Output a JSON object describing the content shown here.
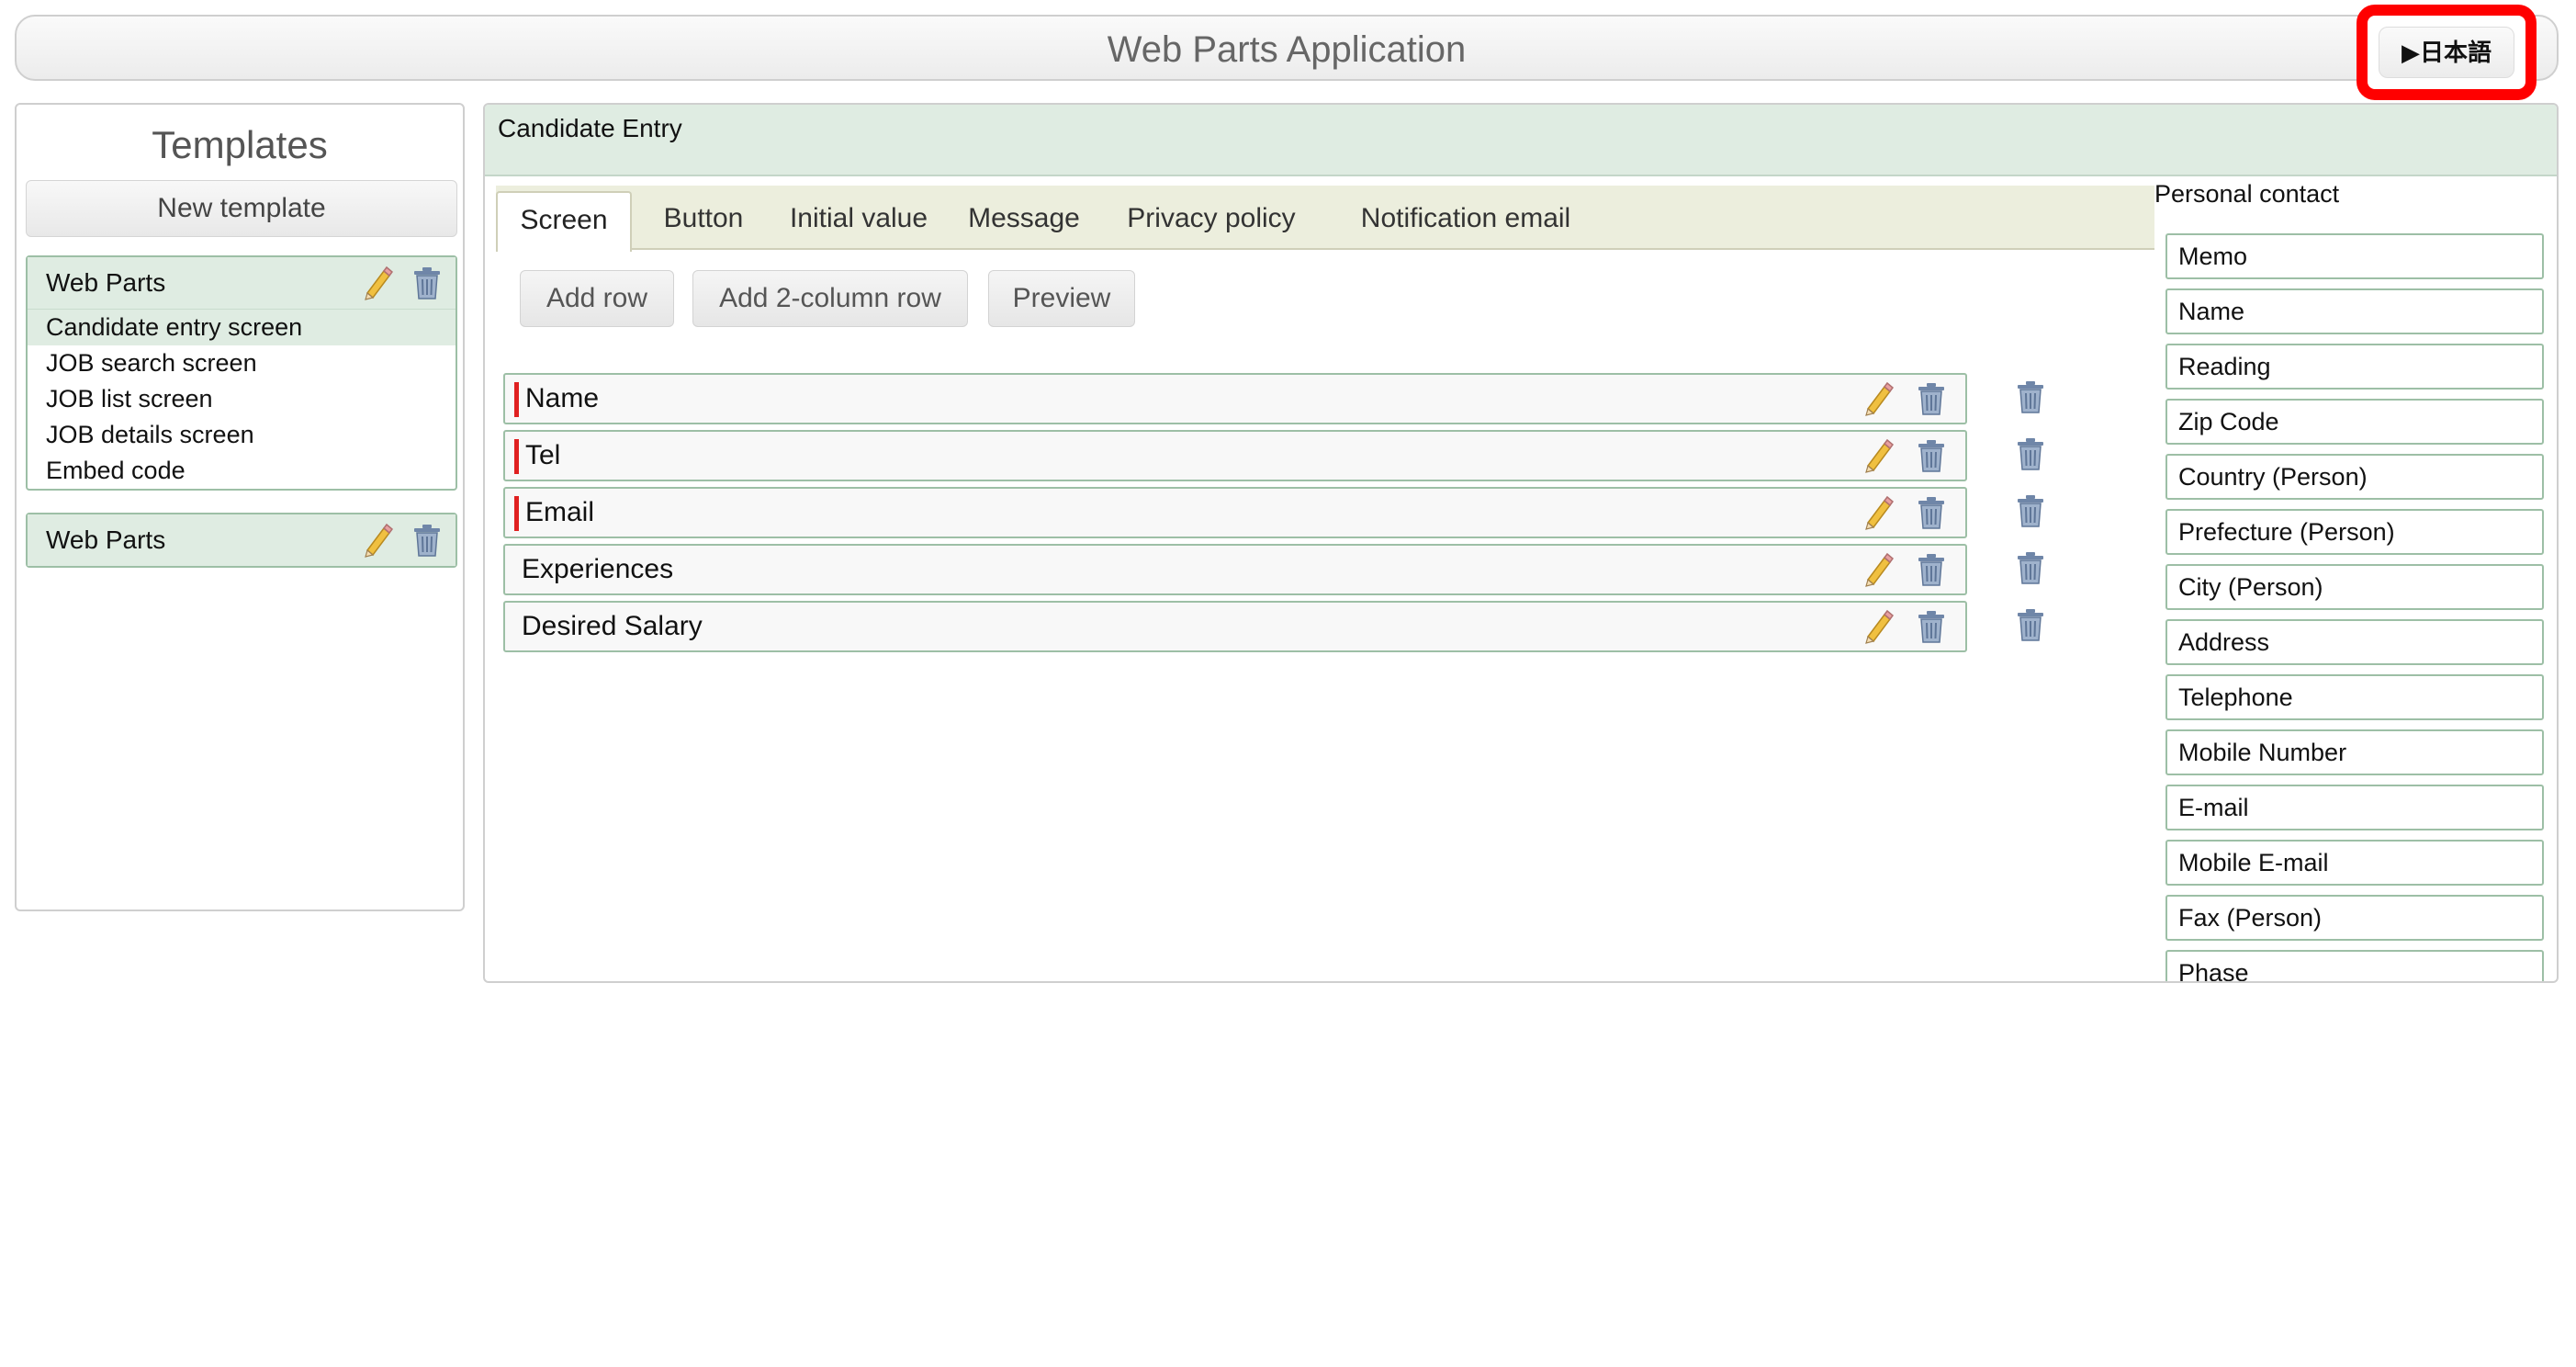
{
  "app": {
    "title": "Web Parts Application",
    "language_button": "▶日本語"
  },
  "templates": {
    "title": "Templates",
    "new_template": "New template",
    "groups": [
      {
        "label": "Web Parts",
        "items": [
          "Candidate entry screen",
          "JOB search screen",
          "JOB list screen",
          "JOB details screen",
          "Embed code"
        ],
        "active_item": "Candidate entry screen"
      },
      {
        "label": "Web Parts",
        "items": []
      }
    ]
  },
  "main": {
    "title": "Candidate Entry",
    "tabs": [
      {
        "label": "Screen",
        "active": true
      },
      {
        "label": "Button"
      },
      {
        "label": "Initial value"
      },
      {
        "label": "Message"
      },
      {
        "label": "Privacy policy"
      },
      {
        "label": "Notification email"
      }
    ],
    "actions": {
      "add_row": "Add row",
      "add_2col_row": "Add 2-column row",
      "preview": "Preview"
    },
    "rows": [
      {
        "label": "Name",
        "required": true
      },
      {
        "label": "Tel",
        "required": true
      },
      {
        "label": "Email",
        "required": true
      },
      {
        "label": "Experiences",
        "required": false
      },
      {
        "label": "Desired Salary",
        "required": false
      }
    ]
  },
  "fields": {
    "title": "Personal contact",
    "items": [
      "Memo",
      "Name",
      "Reading",
      "Zip Code",
      "Country (Person)",
      "Prefecture (Person)",
      "City (Person)",
      "Address",
      "Telephone",
      "Mobile Number",
      "E-mail",
      "Mobile E-mail",
      "Fax (Person)",
      "Phase"
    ]
  },
  "colors": {
    "accent_green": "#dfece2",
    "border_green": "#9dbfa6",
    "required_marker": "#e02020",
    "highlight": "#ff0000"
  },
  "icons": {
    "edit": "pencil-icon",
    "delete": "trash-icon"
  }
}
